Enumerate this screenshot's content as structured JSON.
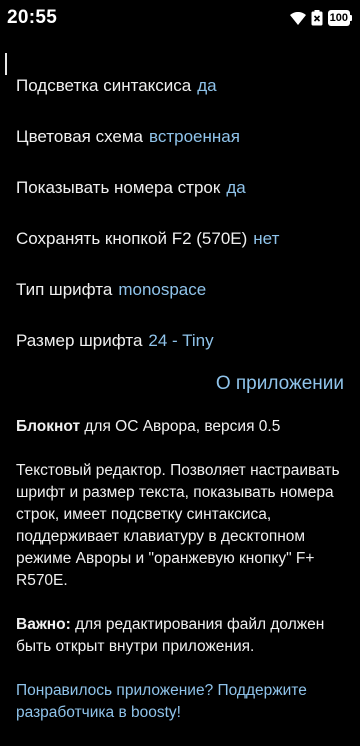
{
  "status_bar": {
    "time": "20:55",
    "battery": "100"
  },
  "settings": [
    {
      "label": "Подсветка синтаксиса",
      "value": "да"
    },
    {
      "label": "Цветовая схема",
      "value": "встроенная"
    },
    {
      "label": "Показывать номера строк",
      "value": "да"
    },
    {
      "label": "Сохранять кнопкой F2 (570E)",
      "value": "нет"
    },
    {
      "label": "Тип шрифта",
      "value": "monospace"
    },
    {
      "label": "Размер шрифта",
      "value": "24 - Tiny"
    }
  ],
  "about": {
    "title": "О приложении",
    "app_name": "Блокнот",
    "version_text": " для ОС Аврора, версия 0.5",
    "description": "Текстовый редактор. Позволяет настраивать шрифт и размер текста, показывать номера строк, имеет подсветку синтаксиса, поддерживает клавиатуру в десктопном режиме Авроры и \"оранжевую кнопку\" F+ R570E.",
    "note_label": "Важно:",
    "note_text": " для редактирования файл должен быть открыт внутри приложения.",
    "support_link": "Понравилось приложение? Поддержите разработчика в boosty!"
  },
  "colors": {
    "background": "#000000",
    "text": "#f0f0f0",
    "accent": "#8fc3ea"
  },
  "icons": [
    "wifi-icon",
    "battery-saver-icon",
    "battery-icon"
  ]
}
